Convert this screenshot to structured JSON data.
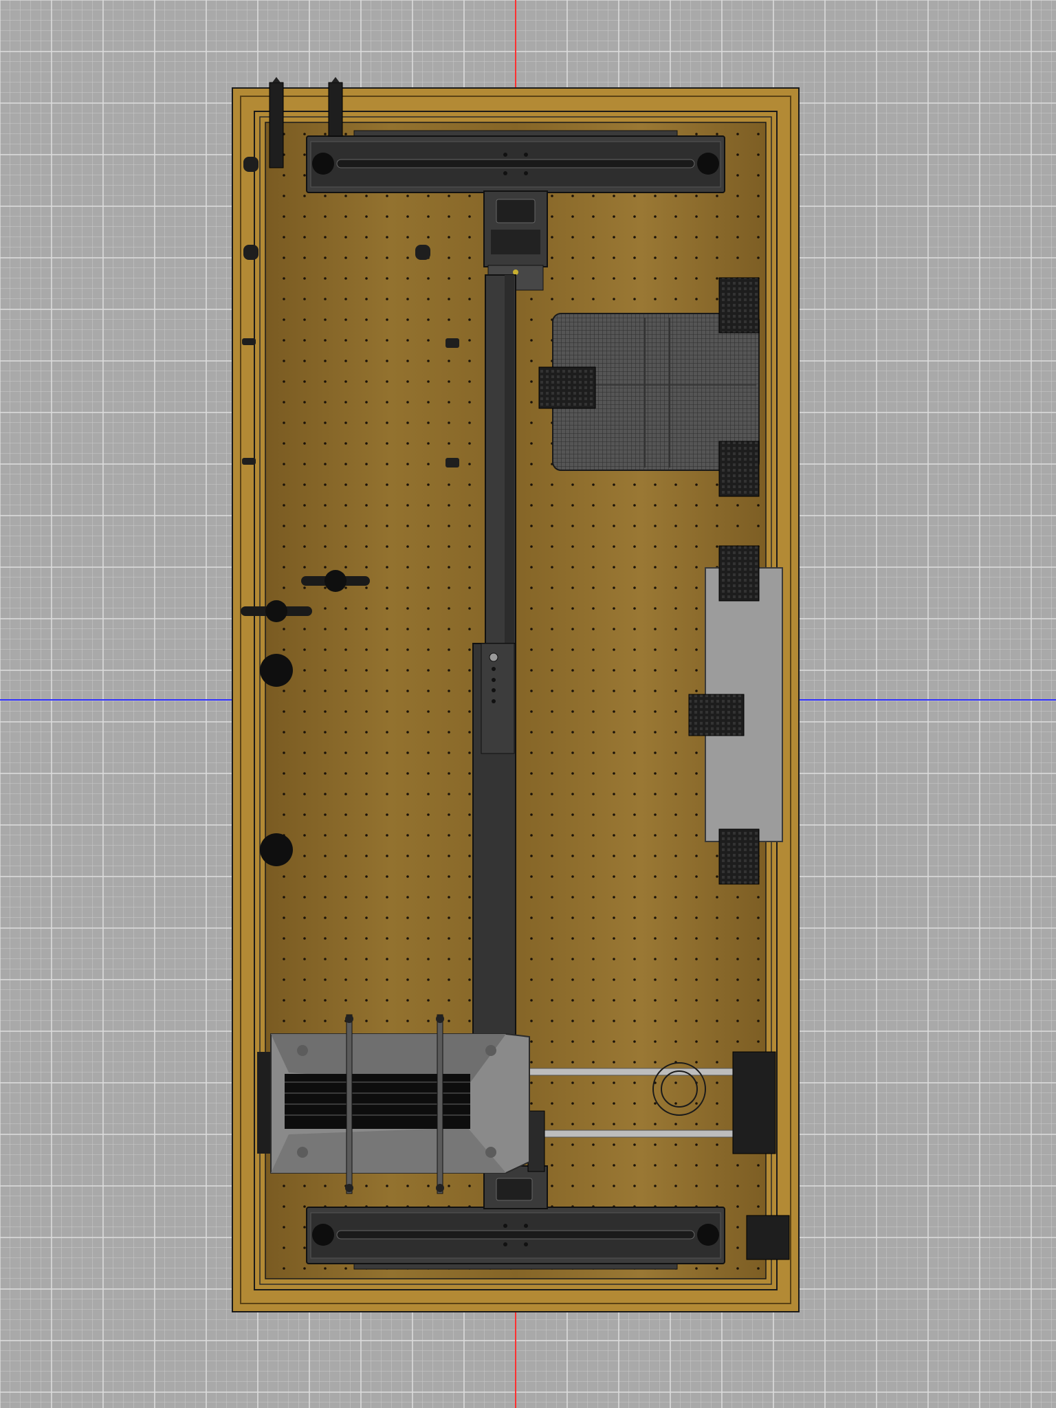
{
  "viewport": {
    "background_color": "#a9a9a9",
    "grid_color": "#d8d8d8",
    "axis_colors": {
      "vertical": "#ff3030",
      "horizontal": "#3030ff"
    }
  },
  "model": {
    "wood_color": "#8a6a2c",
    "frame_wood_color": "#b38a35",
    "part_color_dark": "#2a2a2a",
    "part_color_gray": "#7a7a7a",
    "plate_color": "#9c9c9c"
  }
}
